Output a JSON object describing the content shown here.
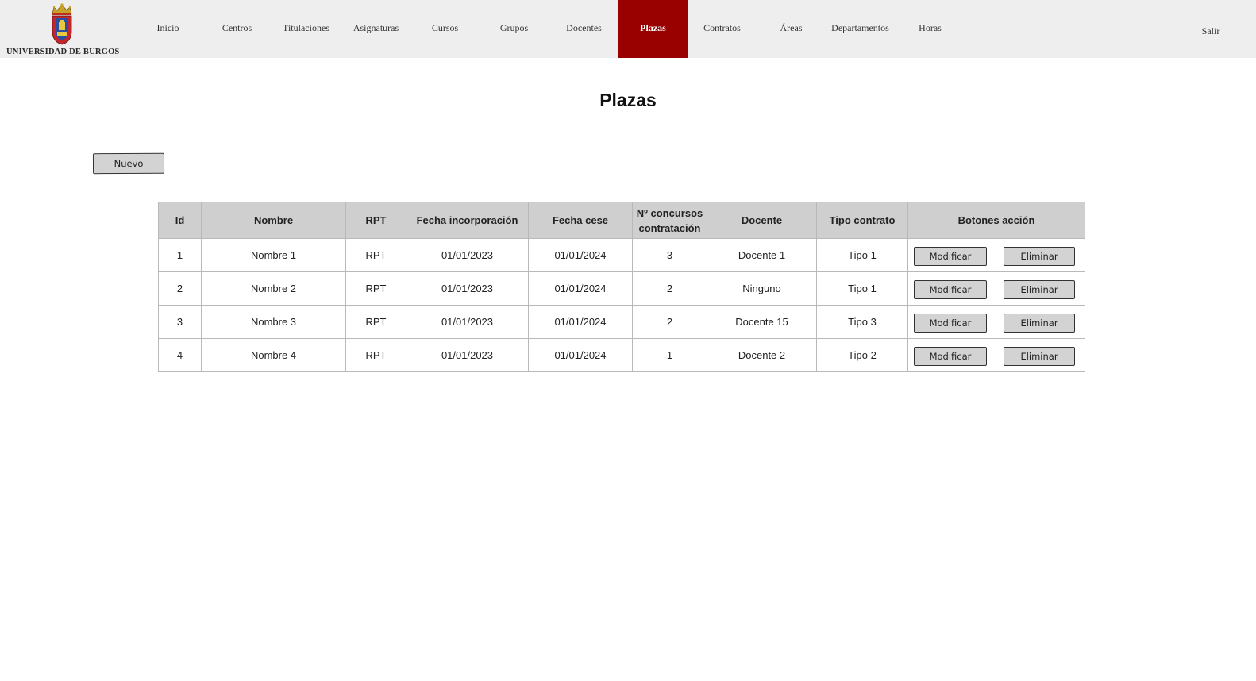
{
  "header": {
    "logo_text": "UNIVERSIDAD DE BURGOS",
    "nav": [
      {
        "label": "Inicio"
      },
      {
        "label": "Centros"
      },
      {
        "label": "Titulaciones"
      },
      {
        "label": "Asignaturas"
      },
      {
        "label": "Cursos"
      },
      {
        "label": "Grupos"
      },
      {
        "label": "Docentes"
      },
      {
        "label": "Plazas",
        "active": true
      },
      {
        "label": "Contratos"
      },
      {
        "label": "Áreas"
      },
      {
        "label": "Departamentos"
      },
      {
        "label": "Horas"
      }
    ],
    "logout_label": "Salir",
    "active_color": "#990000"
  },
  "page": {
    "title": "Plazas",
    "new_button_label": "Nuevo"
  },
  "table": {
    "columns": [
      "Id",
      "Nombre",
      "RPT",
      "Fecha incorporación",
      "Fecha cese",
      "Nº concursos contratación",
      "Docente",
      "Tipo contrato",
      "Botones acción"
    ],
    "rows": [
      {
        "id": "1",
        "nombre": "Nombre 1",
        "rpt": "RPT",
        "fecha_incorporacion": "01/01/2023",
        "fecha_cese": "01/01/2024",
        "concursos": "3",
        "docente": "Docente 1",
        "tipo_contrato": "Tipo 1"
      },
      {
        "id": "2",
        "nombre": "Nombre 2",
        "rpt": "RPT",
        "fecha_incorporacion": "01/01/2023",
        "fecha_cese": "01/01/2024",
        "concursos": "2",
        "docente": "Ninguno",
        "tipo_contrato": "Tipo 1"
      },
      {
        "id": "3",
        "nombre": "Nombre 3",
        "rpt": "RPT",
        "fecha_incorporacion": "01/01/2023",
        "fecha_cese": "01/01/2024",
        "concursos": "2",
        "docente": "Docente 15",
        "tipo_contrato": "Tipo 3"
      },
      {
        "id": "4",
        "nombre": "Nombre 4",
        "rpt": "RPT",
        "fecha_incorporacion": "01/01/2023",
        "fecha_cese": "01/01/2024",
        "concursos": "1",
        "docente": "Docente 2",
        "tipo_contrato": "Tipo 2"
      }
    ],
    "modify_label": "Modificar",
    "delete_label": "Eliminar"
  }
}
